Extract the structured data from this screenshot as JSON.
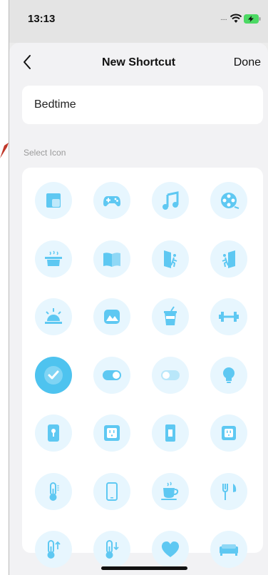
{
  "status_bar": {
    "time": "13:13",
    "signal": "....."
  },
  "nav": {
    "title": "New Shortcut",
    "done_label": "Done"
  },
  "shortcut_name": "Bedtime",
  "section_label": "Select Icon",
  "colors": {
    "accent": "#4ec3ef",
    "cell_bg": "#e7f6fe",
    "icon": "#5ec8f2"
  },
  "icons": [
    {
      "name": "window-icon",
      "selected": false
    },
    {
      "name": "gamepad-icon",
      "selected": false
    },
    {
      "name": "music-icon",
      "selected": false
    },
    {
      "name": "film-reel-icon",
      "selected": false
    },
    {
      "name": "cooking-pot-icon",
      "selected": false
    },
    {
      "name": "book-icon",
      "selected": false
    },
    {
      "name": "walk-in-door-icon",
      "selected": false
    },
    {
      "name": "walk-out-door-icon",
      "selected": false
    },
    {
      "name": "sunrise-icon",
      "selected": false
    },
    {
      "name": "mountain-picture-icon",
      "selected": false
    },
    {
      "name": "drink-cup-icon",
      "selected": false
    },
    {
      "name": "dumbbell-icon",
      "selected": false
    },
    {
      "name": "checkmark-icon",
      "selected": true
    },
    {
      "name": "toggle-on-icon",
      "selected": false
    },
    {
      "name": "toggle-off-icon",
      "selected": false
    },
    {
      "name": "light-bulb-icon",
      "selected": false
    },
    {
      "name": "wall-switch-icon",
      "selected": false
    },
    {
      "name": "power-outlet-icon",
      "selected": false
    },
    {
      "name": "rocker-switch-icon",
      "selected": false
    },
    {
      "name": "smart-plug-icon",
      "selected": false
    },
    {
      "name": "thermometer-icon",
      "selected": false
    },
    {
      "name": "smartphone-icon",
      "selected": false
    },
    {
      "name": "coffee-cup-icon",
      "selected": false
    },
    {
      "name": "fork-knife-icon",
      "selected": false
    },
    {
      "name": "thermometer-up-icon",
      "selected": false
    },
    {
      "name": "thermometer-down-icon",
      "selected": false
    },
    {
      "name": "heart-icon",
      "selected": false
    },
    {
      "name": "sofa-icon",
      "selected": false
    }
  ]
}
